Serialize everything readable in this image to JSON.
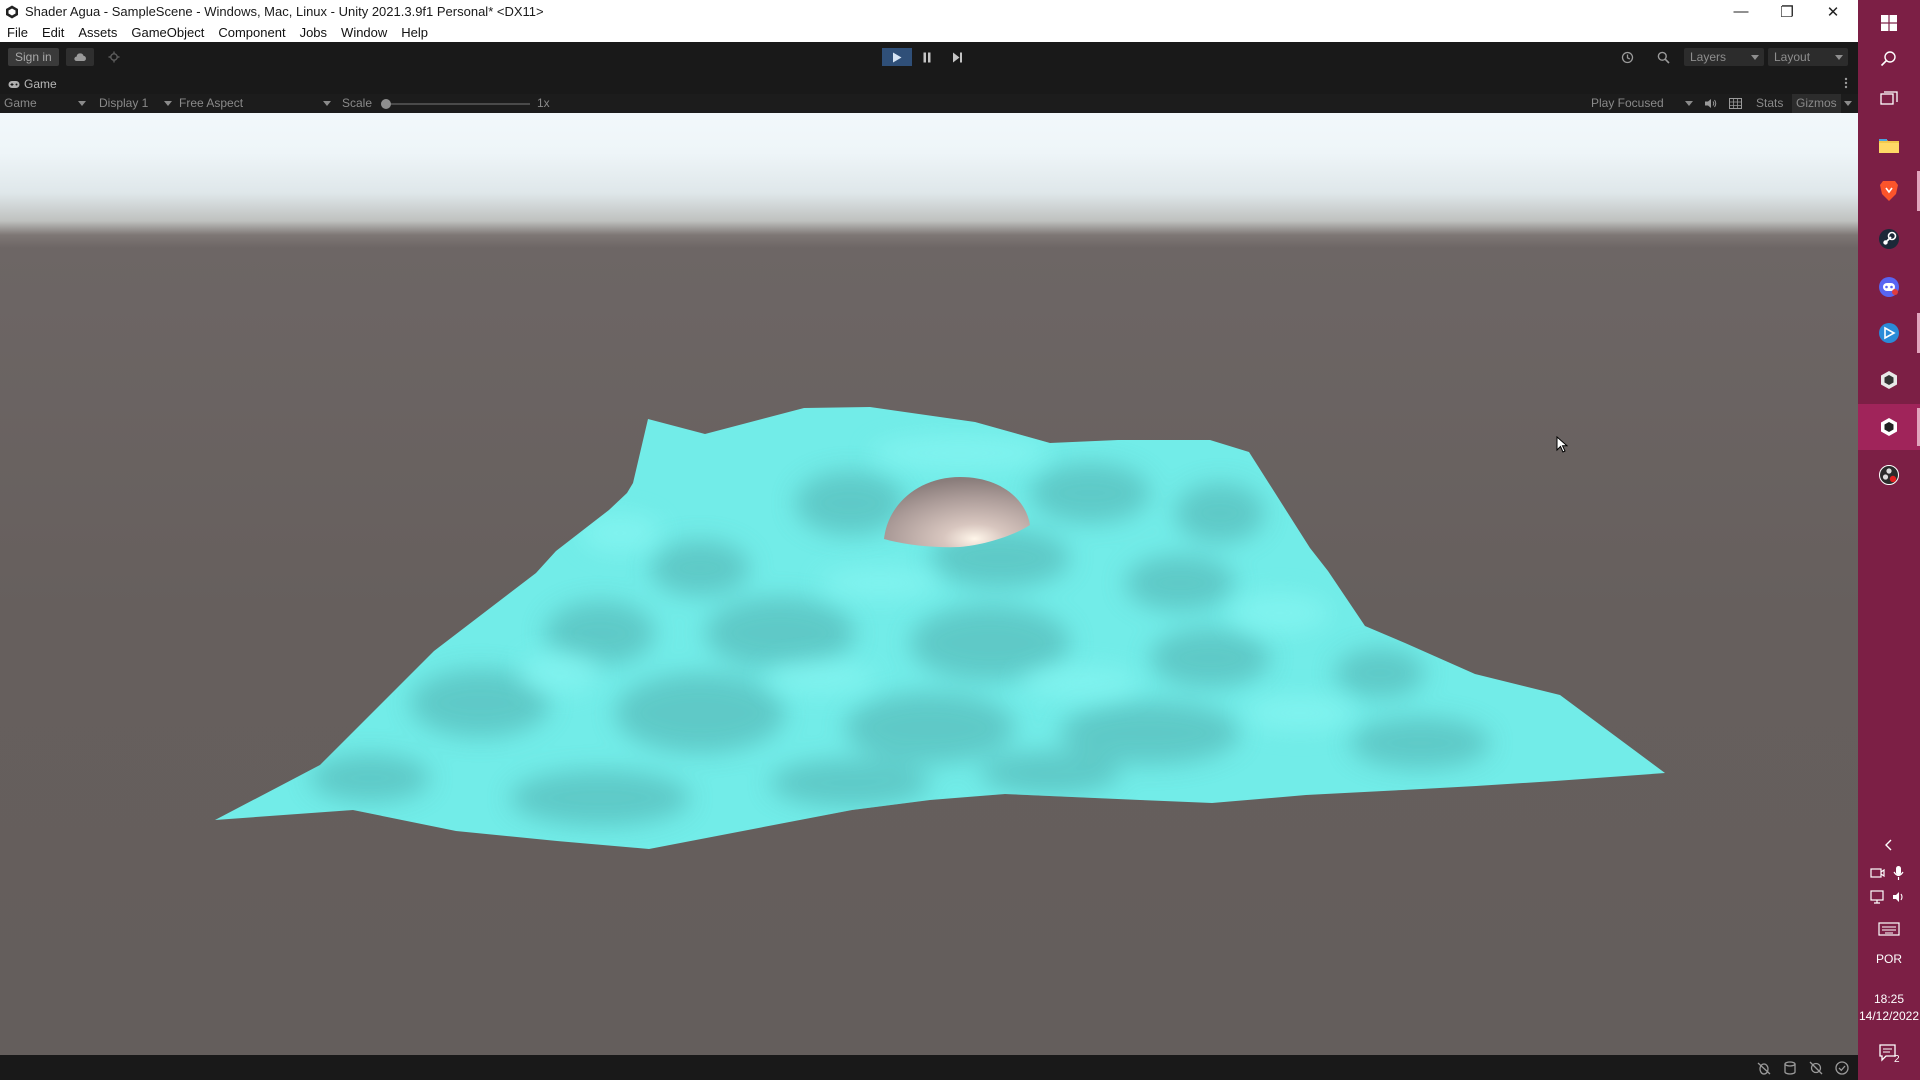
{
  "window": {
    "title": "Shader Agua - SampleScene - Windows, Mac, Linux - Unity 2021.3.9f1 Personal* <DX11>",
    "minimize_glyph": "—",
    "restore_glyph": "❐",
    "close_glyph": "✕"
  },
  "menu": {
    "items": [
      "File",
      "Edit",
      "Assets",
      "GameObject",
      "Component",
      "Jobs",
      "Window",
      "Help"
    ]
  },
  "toolbar": {
    "sign_in_label": "Sign in",
    "layers_label": "Layers",
    "layout_label": "Layout",
    "icons": [
      "cloud-icon",
      "collab-icon",
      "play-icon",
      "pause-icon",
      "step-icon",
      "history-icon",
      "search-icon"
    ]
  },
  "game_view": {
    "tab_label": "Game",
    "game_dropdown": "Game",
    "display_dropdown": "Display 1",
    "aspect_dropdown": "Free Aspect",
    "scale_label": "Scale",
    "scale_value": "1x",
    "play_mode_dropdown": "Play Focused",
    "stats_label": "Stats",
    "gizmos_label": "Gizmos"
  },
  "scene_content": {
    "sky_color": "#eef5f8",
    "ground_color": "#665f5d",
    "water_color": "#6fe9e6",
    "water_shade_color": "#5fc9c6",
    "sphere_color": "#b8a8a4"
  },
  "taskbar": {
    "apps": [
      "windows-start-icon",
      "search-icon",
      "task-view-icon",
      "file-explorer-icon",
      "brave-browser-icon",
      "steam-icon",
      "discord-icon",
      "gamepass-icon",
      "unity-hub-icon",
      "unity-editor-icon",
      "obs-icon"
    ],
    "language": "POR",
    "time": "18:25",
    "date": "14/12/2022",
    "notification_count": "2"
  }
}
